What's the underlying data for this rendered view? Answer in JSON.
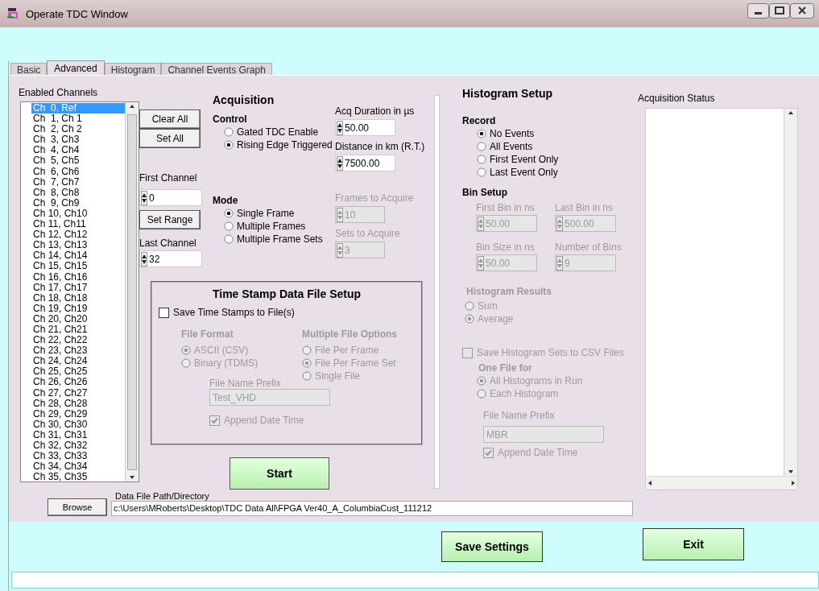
{
  "window": {
    "title": "Operate TDC Window"
  },
  "tabs": [
    {
      "label": "Basic",
      "selected": false
    },
    {
      "label": "Advanced",
      "selected": true
    },
    {
      "label": "Histogram",
      "selected": false
    },
    {
      "label": "Channel Events Graph",
      "selected": false
    }
  ],
  "channels": {
    "label": "Enabled Channels",
    "items": [
      {
        "label": "Ch  0, Ref",
        "selected": true
      },
      {
        "label": "Ch  1, Ch 1",
        "selected": false
      },
      {
        "label": "Ch  2, Ch 2",
        "selected": false
      },
      {
        "label": "Ch  3, Ch3",
        "selected": false
      },
      {
        "label": "Ch  4, Ch4",
        "selected": false
      },
      {
        "label": "Ch  5, Ch5",
        "selected": false
      },
      {
        "label": "Ch  6, Ch6",
        "selected": false
      },
      {
        "label": "Ch  7, Ch7",
        "selected": false
      },
      {
        "label": "Ch  8, Ch8",
        "selected": false
      },
      {
        "label": "Ch  9, Ch9",
        "selected": false
      },
      {
        "label": "Ch 10, Ch10",
        "selected": false
      },
      {
        "label": "Ch 11, Ch11",
        "selected": false
      },
      {
        "label": "Ch 12, Ch12",
        "selected": false
      },
      {
        "label": "Ch 13, Ch13",
        "selected": false
      },
      {
        "label": "Ch 14, Ch14",
        "selected": false
      },
      {
        "label": "Ch 15, Ch15",
        "selected": false
      },
      {
        "label": "Ch 16, Ch16",
        "selected": false
      },
      {
        "label": "Ch 17, Ch17",
        "selected": false
      },
      {
        "label": "Ch 18, Ch18",
        "selected": false
      },
      {
        "label": "Ch 19, Ch19",
        "selected": false
      },
      {
        "label": "Ch 20, Ch20",
        "selected": false
      },
      {
        "label": "Ch 21, Ch21",
        "selected": false
      },
      {
        "label": "Ch 22, Ch22",
        "selected": false
      },
      {
        "label": "Ch 23, Ch23",
        "selected": false
      },
      {
        "label": "Ch 24, Ch24",
        "selected": false
      },
      {
        "label": "Ch 25, Ch25",
        "selected": false
      },
      {
        "label": "Ch 26, Ch26",
        "selected": false
      },
      {
        "label": "Ch 27, Ch27",
        "selected": false
      },
      {
        "label": "Ch 28, Ch28",
        "selected": false
      },
      {
        "label": "Ch 29, Ch29",
        "selected": false
      },
      {
        "label": "Ch 30, Ch30",
        "selected": false
      },
      {
        "label": "Ch 31, Ch31",
        "selected": false
      },
      {
        "label": "Ch 32, Ch32",
        "selected": false
      },
      {
        "label": "Ch 33, Ch33",
        "selected": false
      },
      {
        "label": "Ch 34, Ch34",
        "selected": false
      },
      {
        "label": "Ch 35, Ch35",
        "selected": false
      }
    ]
  },
  "channel_buttons": [
    "Clear All",
    "Set All"
  ],
  "first_channel": {
    "label": "First Channel",
    "value": "0",
    "disabled": false
  },
  "set_range_button": "Set Range",
  "last_channel": {
    "label": "Last Channel",
    "value": "32",
    "disabled": false
  },
  "acquisition": {
    "title": "Acquisition",
    "control": {
      "label": "Control",
      "disabled": false,
      "options": [
        {
          "label": "Gated TDC Enable",
          "selected": false
        },
        {
          "label": "Rising Edge Triggered",
          "selected": true
        }
      ]
    },
    "mode": {
      "label": "Mode",
      "disabled": false,
      "options": [
        {
          "label": "Single Frame",
          "selected": true
        },
        {
          "label": "Multiple Frames",
          "selected": false
        },
        {
          "label": "Multiple Frame Sets",
          "selected": false
        }
      ]
    },
    "acq_duration": {
      "label": "Acq Duration in µs",
      "value": "50.00",
      "disabled": false
    },
    "distance": {
      "label": "Distance in km (R.T.)",
      "value": "7500.00",
      "disabled": false
    },
    "frames_to_acquire": {
      "label": "Frames to Acquire",
      "value": "10",
      "disabled": true
    },
    "sets_to_acquire": {
      "label": "Sets to Acquire",
      "value": "3",
      "disabled": true
    }
  },
  "time_stamp": {
    "title": "Time Stamp Data File Setup",
    "save": {
      "label": "Save Time Stamps to File(s)",
      "checked": false,
      "disabled": false
    },
    "file_format": {
      "label": "File Format",
      "disabled": true,
      "options": [
        {
          "label": "ASCII (CSV)",
          "selected": true
        },
        {
          "label": "Binary (TDMS)",
          "selected": false
        }
      ]
    },
    "multiple_file_options": {
      "label": "Multiple File Options",
      "disabled": true,
      "options": [
        {
          "label": "File Per Frame",
          "selected": false
        },
        {
          "label": "File Per Frame Set",
          "selected": true
        },
        {
          "label": "Single File",
          "selected": false
        }
      ]
    },
    "file_name_prefix": {
      "label": "File Name Prefix",
      "value": "Test_VHD",
      "disabled": true
    },
    "append_date_time": {
      "label": "Append Date Time",
      "checked": true,
      "disabled": true
    }
  },
  "start_button": "Start",
  "histogram": {
    "title": "Histogram Setup",
    "record": {
      "label": "Record",
      "disabled": false,
      "options": [
        {
          "label": "No Events",
          "selected": true
        },
        {
          "label": "All Events",
          "selected": false
        },
        {
          "label": "First Event Only",
          "selected": false
        },
        {
          "label": "Last Event Only",
          "selected": false
        }
      ]
    },
    "bin_setup": {
      "label": "Bin Setup",
      "fields": [
        {
          "label": "First Bin in ns",
          "value": "50.00",
          "disabled": true
        },
        {
          "label": "Last Bin in ns",
          "value": "500.00",
          "disabled": true
        },
        {
          "label": "Bin Size in ns",
          "value": "50.00",
          "disabled": true
        },
        {
          "label": "Number of Bins",
          "value": "9",
          "disabled": true
        }
      ]
    },
    "results": {
      "label": "Histogram Results",
      "disabled": true,
      "options": [
        {
          "label": "Sum",
          "selected": false
        },
        {
          "label": "Average",
          "selected": true
        }
      ]
    },
    "save_sets": {
      "label": "Save Histogram Sets to CSV Files",
      "checked": false,
      "disabled": true
    },
    "one_file_for": {
      "label": "One File for",
      "disabled": true,
      "options": [
        {
          "label": "All Histograms in Run",
          "selected": true
        },
        {
          "label": "Each Histogram",
          "selected": false
        }
      ]
    },
    "file_name_prefix": {
      "label": "File Name Prefix",
      "value": "MBR",
      "disabled": true
    },
    "append_date_time": {
      "label": "Append Date Time",
      "checked": true,
      "disabled": true
    }
  },
  "acquisition_status": {
    "label": "Acquisition Status"
  },
  "data_file": {
    "browse_button": "Browse",
    "label": "Data File Path/Directory",
    "value": "c:\\Users\\MRoberts\\Desktop\\TDC Data All\\FPGA Ver40_A_ColumbiaCust_111212"
  },
  "footer_buttons": [
    "Save Settings",
    "Exit"
  ]
}
